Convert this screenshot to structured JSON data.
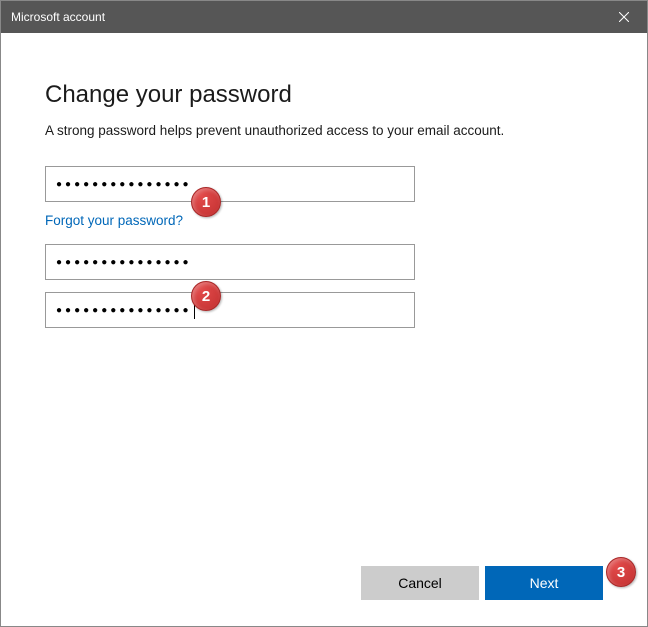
{
  "titlebar": {
    "title": "Microsoft account"
  },
  "main": {
    "heading": "Change your password",
    "subtext": "A strong password helps prevent unauthorized access to your email account.",
    "current_password_dots": "●●●●●●●●●●●●●●●",
    "forgot_link": "Forgot your password?",
    "new_password_dots": "●●●●●●●●●●●●●●●",
    "confirm_password_dots": "●●●●●●●●●●●●●●●"
  },
  "footer": {
    "cancel_label": "Cancel",
    "next_label": "Next"
  },
  "annotations": {
    "a1": "1",
    "a2": "2",
    "a3": "3"
  }
}
